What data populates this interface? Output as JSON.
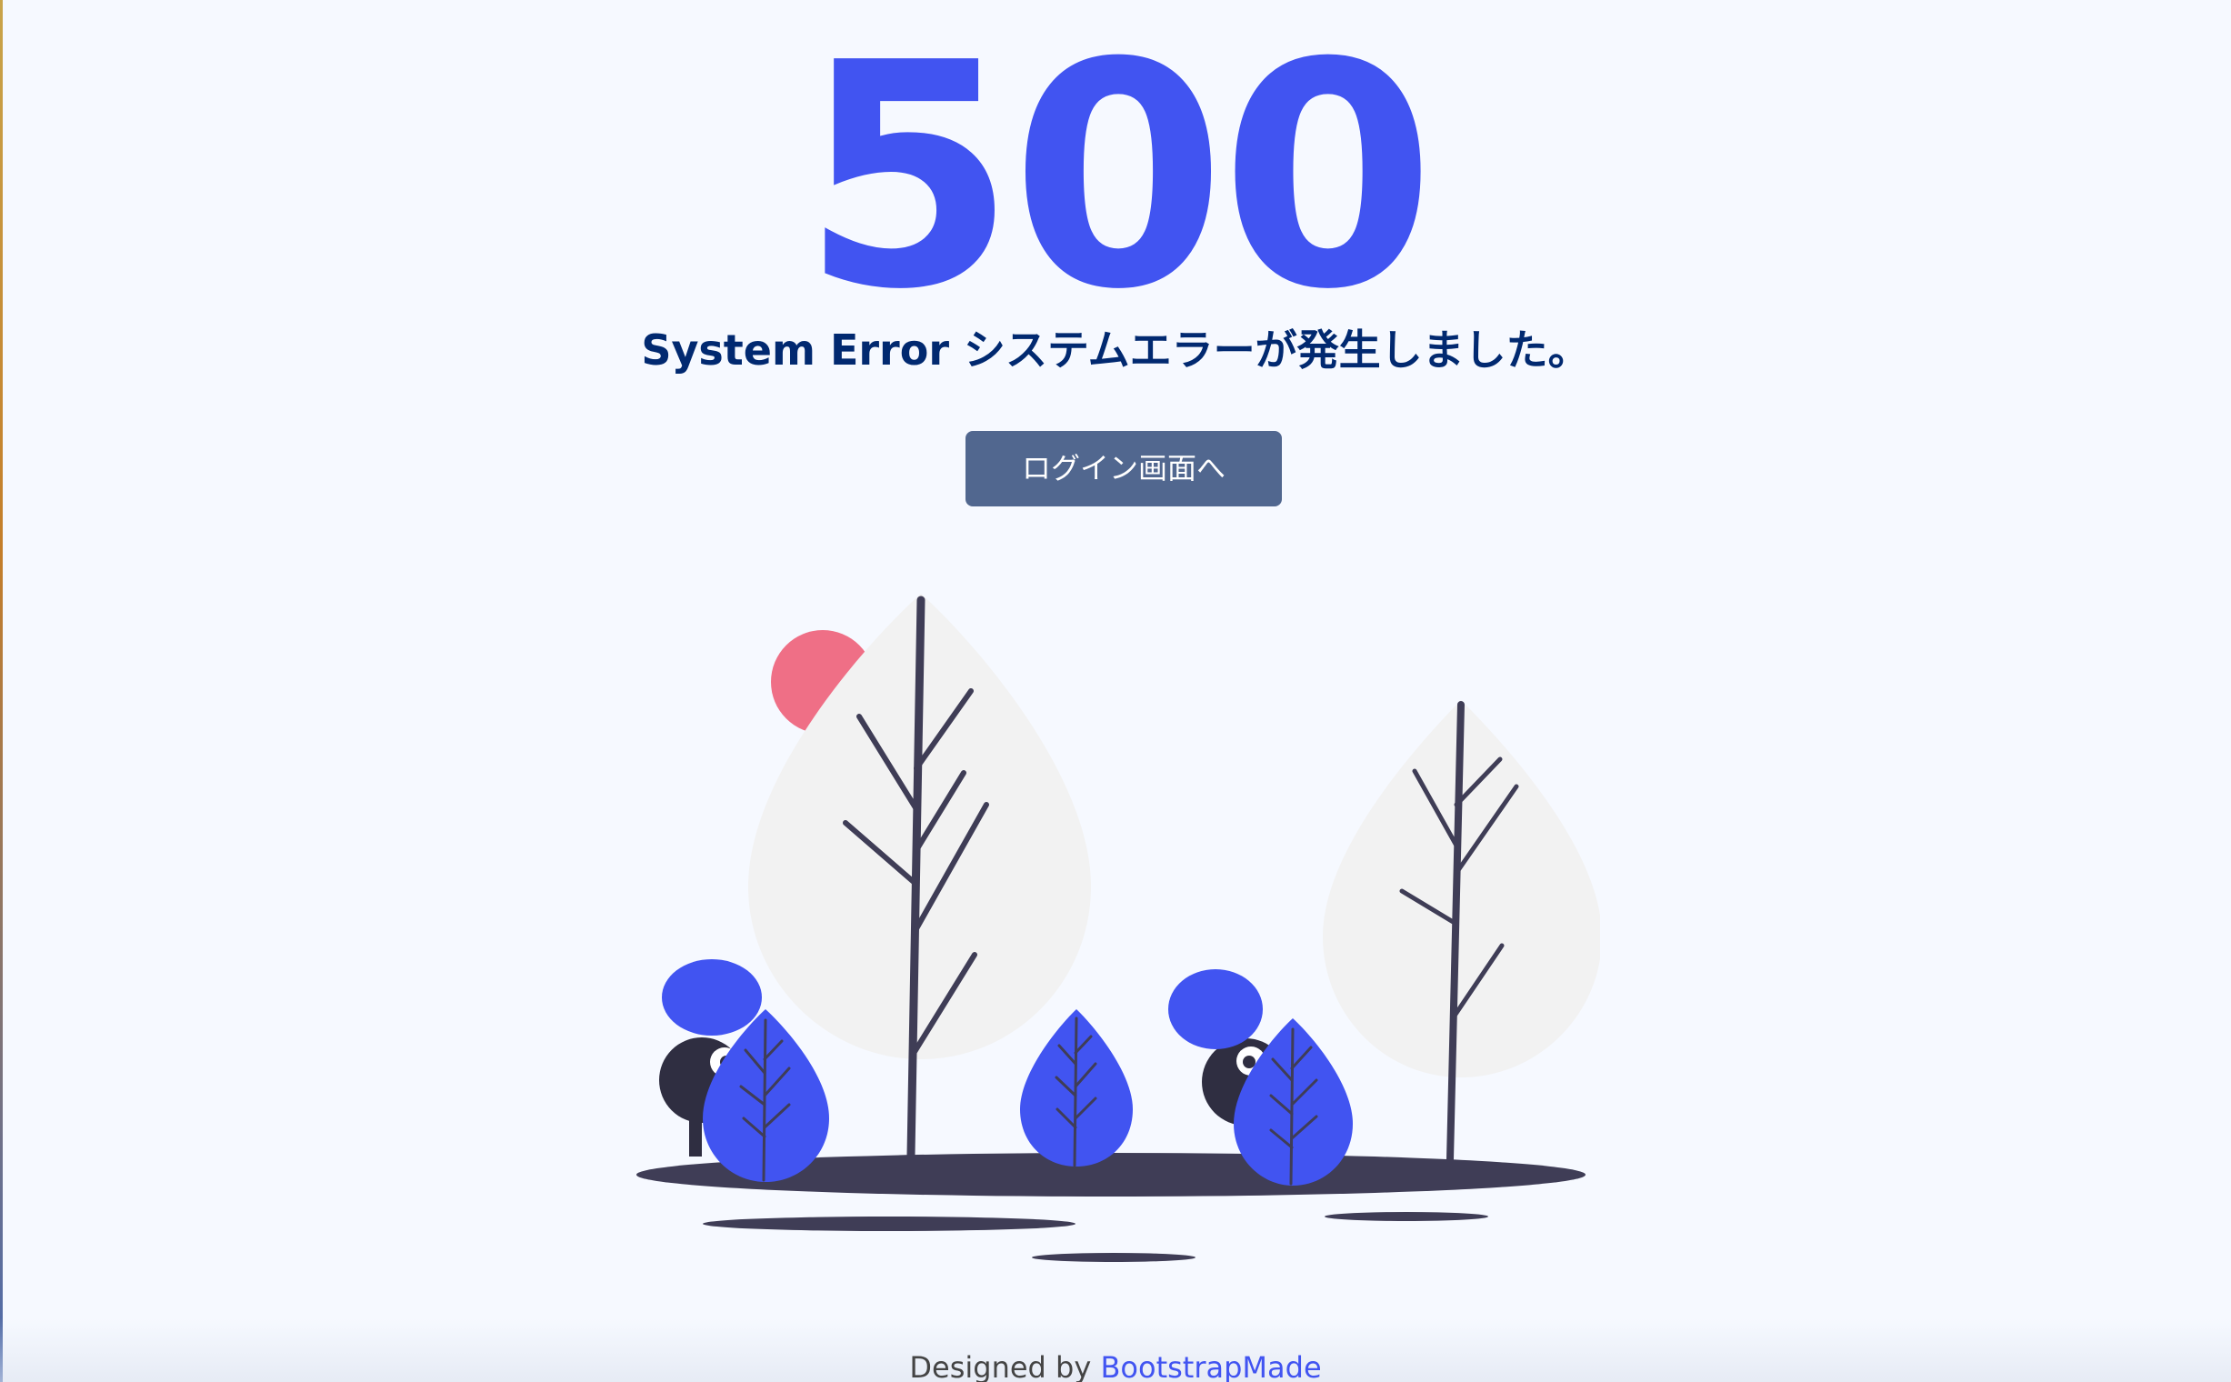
{
  "error": {
    "code": "500",
    "message": "System Error システムエラーが発生しました。"
  },
  "actions": {
    "login_button_label": "ログイン画面へ"
  },
  "footer": {
    "designed_by_text": "Designed by",
    "designer_link_text": "BootstrapMade"
  },
  "colors": {
    "accent": "#4154f1",
    "heading": "#012970",
    "button_bg": "#51678f",
    "background": "#f6f9ff",
    "sun": "#ef6f86",
    "tree_leaf": "#f2f2f2",
    "ground": "#3f3d56"
  }
}
